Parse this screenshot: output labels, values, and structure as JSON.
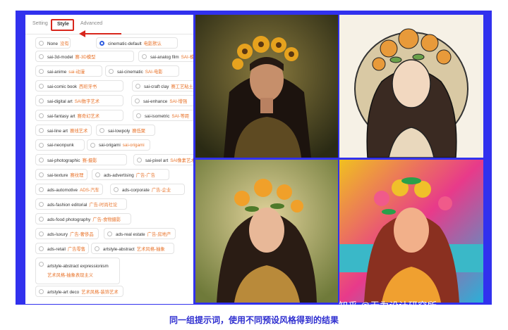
{
  "tabs": {
    "setting": "Setting",
    "style": "Style",
    "advanced": "Advanced"
  },
  "options": [
    {
      "en": "None",
      "cn": "没有",
      "selected": false
    },
    {
      "en": "cinematic-default",
      "cn": "电影默认",
      "selected": true
    },
    {
      "en": "sai-3d-model",
      "cn": "赛-3D模型",
      "selected": false
    },
    {
      "en": "sai-analog film",
      "cn": "SAI-模拟胶片",
      "selected": false
    },
    {
      "en": "sai-anime",
      "cn": "sai-动漫",
      "selected": false
    },
    {
      "en": "sai-cinematic",
      "cn": "SAI-电影",
      "selected": false
    },
    {
      "en": "sai-comic book",
      "cn": "西班牙书",
      "selected": false
    },
    {
      "en": "sai-craft clay",
      "cn": "赛工艺粘土",
      "selected": false
    },
    {
      "en": "sai-digital art",
      "cn": "SAI数字艺术",
      "selected": false
    },
    {
      "en": "sai-enhance",
      "cn": "SAI-增强",
      "selected": false
    },
    {
      "en": "sai-fantasy art",
      "cn": "赛奇幻艺术",
      "selected": false
    },
    {
      "en": "sai-isometric",
      "cn": "SAI-等距",
      "selected": false
    },
    {
      "en": "sai-line art",
      "cn": "赛线艺术",
      "selected": false
    },
    {
      "en": "sai-lowpoly",
      "cn": "赛低聚",
      "selected": false
    },
    {
      "en": "sai-neonpunk",
      "cn": "",
      "selected": false
    },
    {
      "en": "sai-origami",
      "cn": "sai-origami",
      "selected": false
    },
    {
      "en": "sai-photographic",
      "cn": "赛-摄影",
      "selected": false
    },
    {
      "en": "sai-pixel art",
      "cn": "SAI像素艺术",
      "selected": false
    },
    {
      "en": "sai-texture",
      "cn": "赛纹理",
      "selected": false
    },
    {
      "en": "ads-advertising",
      "cn": "广告-广告",
      "selected": false
    },
    {
      "en": "ads-automotive",
      "cn": "ADS-汽车",
      "selected": false
    },
    {
      "en": "ads-corporate",
      "cn": "广告-企业",
      "selected": false
    },
    {
      "en": "ads-fashion editorial",
      "cn": "广告-时尚社论",
      "selected": false
    },
    {
      "en": "ads-food photography",
      "cn": "广告-食物摄影",
      "selected": false
    },
    {
      "en": "ads-luxury",
      "cn": "广告-奢侈品",
      "selected": false
    },
    {
      "en": "ads-real estate",
      "cn": "广告-房地产",
      "selected": false
    },
    {
      "en": "ads-retail",
      "cn": "广告零售",
      "selected": false
    },
    {
      "en": "artstyle-abstract",
      "cn": "艺术风格-抽象",
      "selected": false
    },
    {
      "en": "artstyle-abstract expressionism",
      "cn": "艺术风格-抽象表现主义",
      "selected": false
    },
    {
      "en": "artstyle-art deco",
      "cn": "艺术风格-装饰艺术",
      "selected": false
    }
  ],
  "images": [
    {
      "alt": "realistic woman with sunflower crown"
    },
    {
      "alt": "line art woman with flower crown"
    },
    {
      "alt": "painted woman with flower crown"
    },
    {
      "alt": "colorful fantasy woman with flower crown"
    }
  ],
  "caption": "同一组提示词，使用不同预设风格得到的结果",
  "watermark": "知乎 @无为设计研究所",
  "colors": {
    "frame": "#3131ee",
    "highlight": "#d8261c",
    "cn_text": "#e8732a",
    "radio_selected": "#2f5de0"
  }
}
